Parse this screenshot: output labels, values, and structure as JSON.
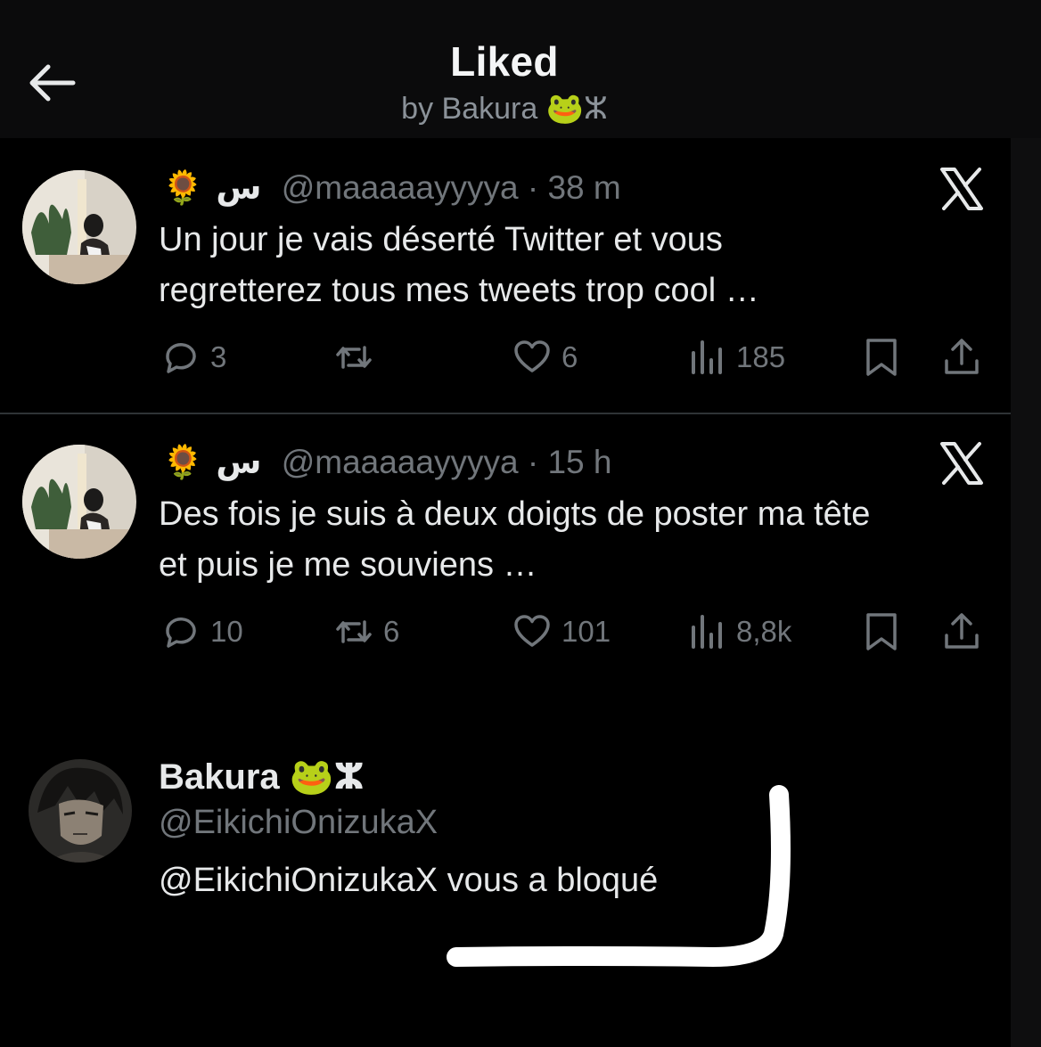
{
  "header": {
    "title": "Liked",
    "subtitle_prefix": "by Bakura ",
    "subtitle_emoji": "🐸",
    "subtitle_suffix": "ⵣ"
  },
  "tweets": [
    {
      "name_emoji": "🌻",
      "name_text": "س",
      "handle": "@maaaaayyyya",
      "separator": "·",
      "time": "38 m",
      "text_line1": "Un jour je vais déserté Twitter et vous",
      "text_line2": "regretterez tous mes tweets trop cool …",
      "replies": "3",
      "retweets": "",
      "likes": "6",
      "views": "185"
    },
    {
      "name_emoji": "🌻",
      "name_text": "س",
      "handle": "@maaaaayyyya",
      "separator": "·",
      "time": "15 h",
      "text_line1": "Des fois je suis à deux doigts de poster ma tête",
      "text_line2": "et puis je me souviens …",
      "replies": "10",
      "retweets": "6",
      "likes": "101",
      "views": "8,8k"
    }
  ],
  "blocked": {
    "name": "Bakura ",
    "name_emoji": "🐸",
    "name_suffix": "ⵣ",
    "handle": "@EikichiOnizukaX",
    "message": "@EikichiOnizukaX vous a bloqué"
  },
  "colors": {
    "background": "#000000",
    "text": "#e7e9ea",
    "muted": "#71767b",
    "divider": "#2f3336"
  },
  "icons": [
    "back-arrow-icon",
    "x-logo-icon",
    "reply-icon",
    "retweet-icon",
    "like-icon",
    "views-icon",
    "bookmark-icon",
    "share-icon"
  ]
}
